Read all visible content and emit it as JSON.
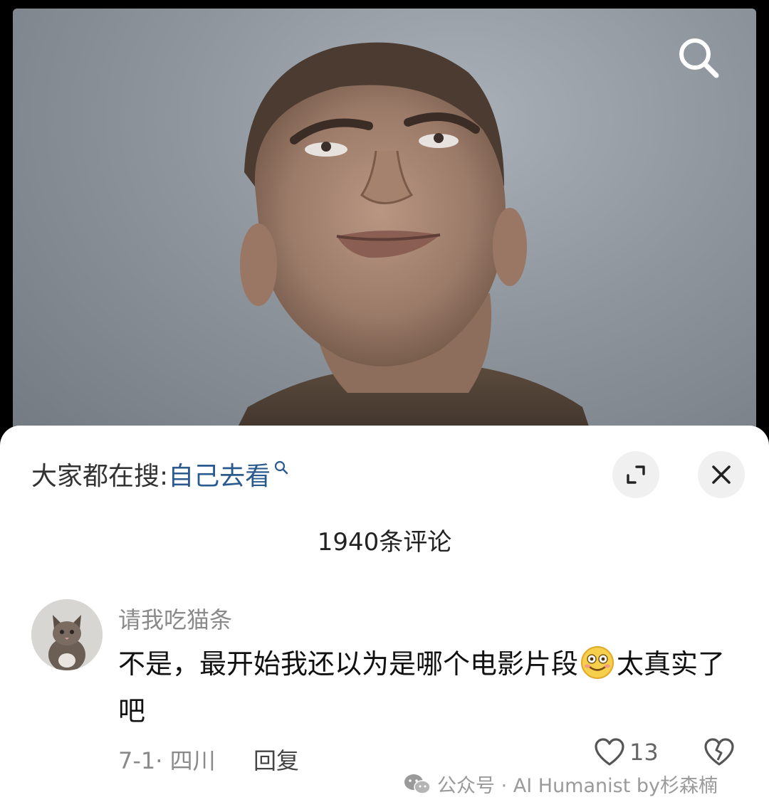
{
  "search_bar": {
    "prefix": "大家都在搜:",
    "keyword": "自己去看"
  },
  "header": {
    "comment_count": "1940条评论"
  },
  "comment": {
    "username": "请我吃猫条",
    "text_before_emoji": "不是，最开始我还以为是哪个电影片段",
    "text_after_emoji": "太真实了吧",
    "meta": "7-1· 四川",
    "reply_label": "回复",
    "like_count": "13"
  },
  "watermark": {
    "text": "公众号 · AI Humanist by杉森楠"
  },
  "icons": {
    "search": "search-icon",
    "expand": "expand-icon",
    "close": "close-icon",
    "heart": "heart-icon",
    "broken_heart": "broken-heart-icon",
    "emoji": "smile-emoji-icon",
    "wechat": "wechat-icon"
  },
  "colors": {
    "keyword": "#2a5a8e",
    "meta_gray": "#8a8a8a",
    "sheet_bg": "#ffffff",
    "page_bg": "#000000"
  }
}
